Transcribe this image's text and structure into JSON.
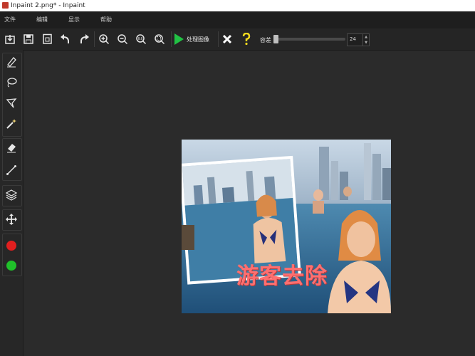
{
  "window": {
    "title": "Inpaint 2.png* - Inpaint"
  },
  "menu": {
    "file": "文件",
    "edit": "编辑",
    "view": "显示",
    "help": "帮助"
  },
  "toolbar": {
    "process_label": "处理图像",
    "tolerance_label": "容差",
    "tolerance_value": "24",
    "tolerance_max": "100"
  },
  "canvas": {
    "overlay_text": "游客去除"
  },
  "colors": {
    "accent_green": "#21c244",
    "cancel_white": "#ffffff",
    "help_yellow": "#f2d91e",
    "marker_red": "#e21f1f",
    "marker_green": "#20c02a"
  },
  "icons": {
    "toolbar": [
      "open-icon",
      "save-icon",
      "save-as-icon",
      "undo-icon",
      "redo-icon",
      "zoom-in-icon",
      "zoom-out-icon",
      "zoom-actual-icon",
      "zoom-fit-icon",
      "play-icon",
      "cancel-icon",
      "help-icon"
    ],
    "left": [
      "marker-icon",
      "lasso-icon",
      "polygon-lasso-icon",
      "magic-wand-icon",
      "eraser-icon",
      "line-icon",
      "layers-icon",
      "move-icon"
    ]
  }
}
